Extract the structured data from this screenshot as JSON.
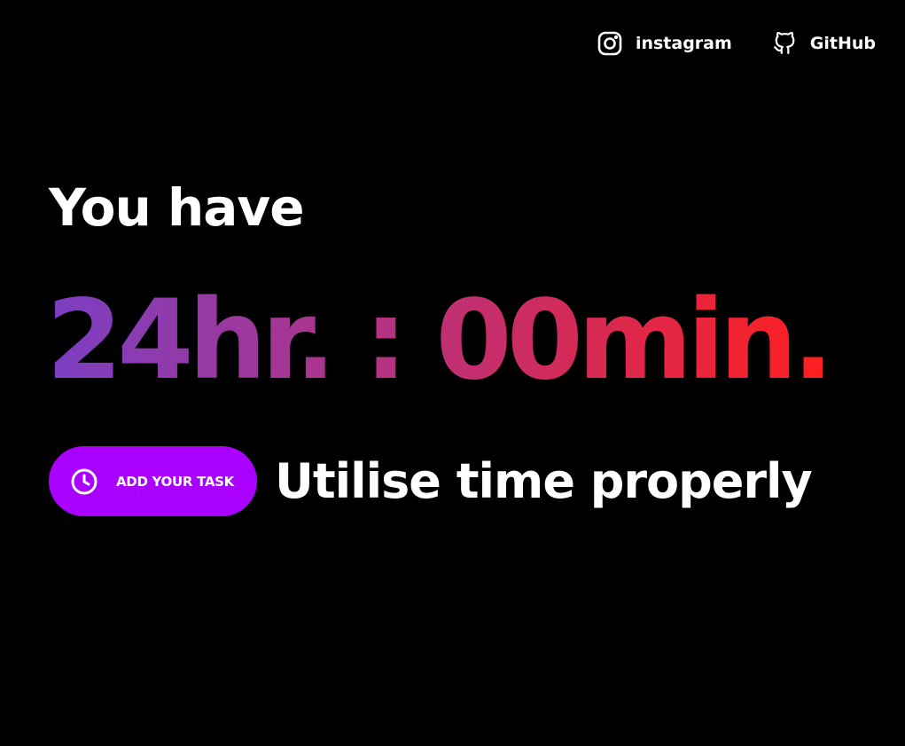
{
  "nav": {
    "instagram": {
      "label": "instagram",
      "icon": "instagram-icon"
    },
    "github": {
      "label": "GitHub",
      "icon": "github-icon"
    }
  },
  "hero": {
    "headline": "You have",
    "timer": "24hr. : 00min.",
    "tagline": "Utilise time properly"
  },
  "cta": {
    "label": "ADD YOUR TASK",
    "icon": "clock-icon"
  },
  "colors": {
    "background": "#000000",
    "text": "#ffffff",
    "button": "#aa00ff",
    "gradient_start": "#7b3fc4",
    "gradient_mid": "#c42f6e",
    "gradient_end": "#ff1e1e"
  }
}
